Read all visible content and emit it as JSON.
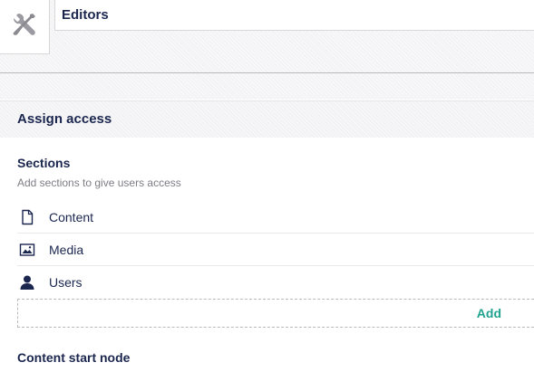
{
  "group": {
    "icon": "tools-icon",
    "name_value": "Editors"
  },
  "assign_access": {
    "title": "Assign access"
  },
  "sections": {
    "label": "Sections",
    "description": "Add sections to give users access",
    "items": [
      {
        "label": "Content",
        "icon": "document-icon"
      },
      {
        "label": "Media",
        "icon": "image-icon"
      },
      {
        "label": "Users",
        "icon": "user-icon"
      }
    ],
    "add_label": "Add"
  },
  "content_start_node": {
    "label": "Content start node"
  },
  "colors": {
    "text": "#1b264f",
    "muted": "#7d7d86",
    "accent": "#1fa38e"
  }
}
